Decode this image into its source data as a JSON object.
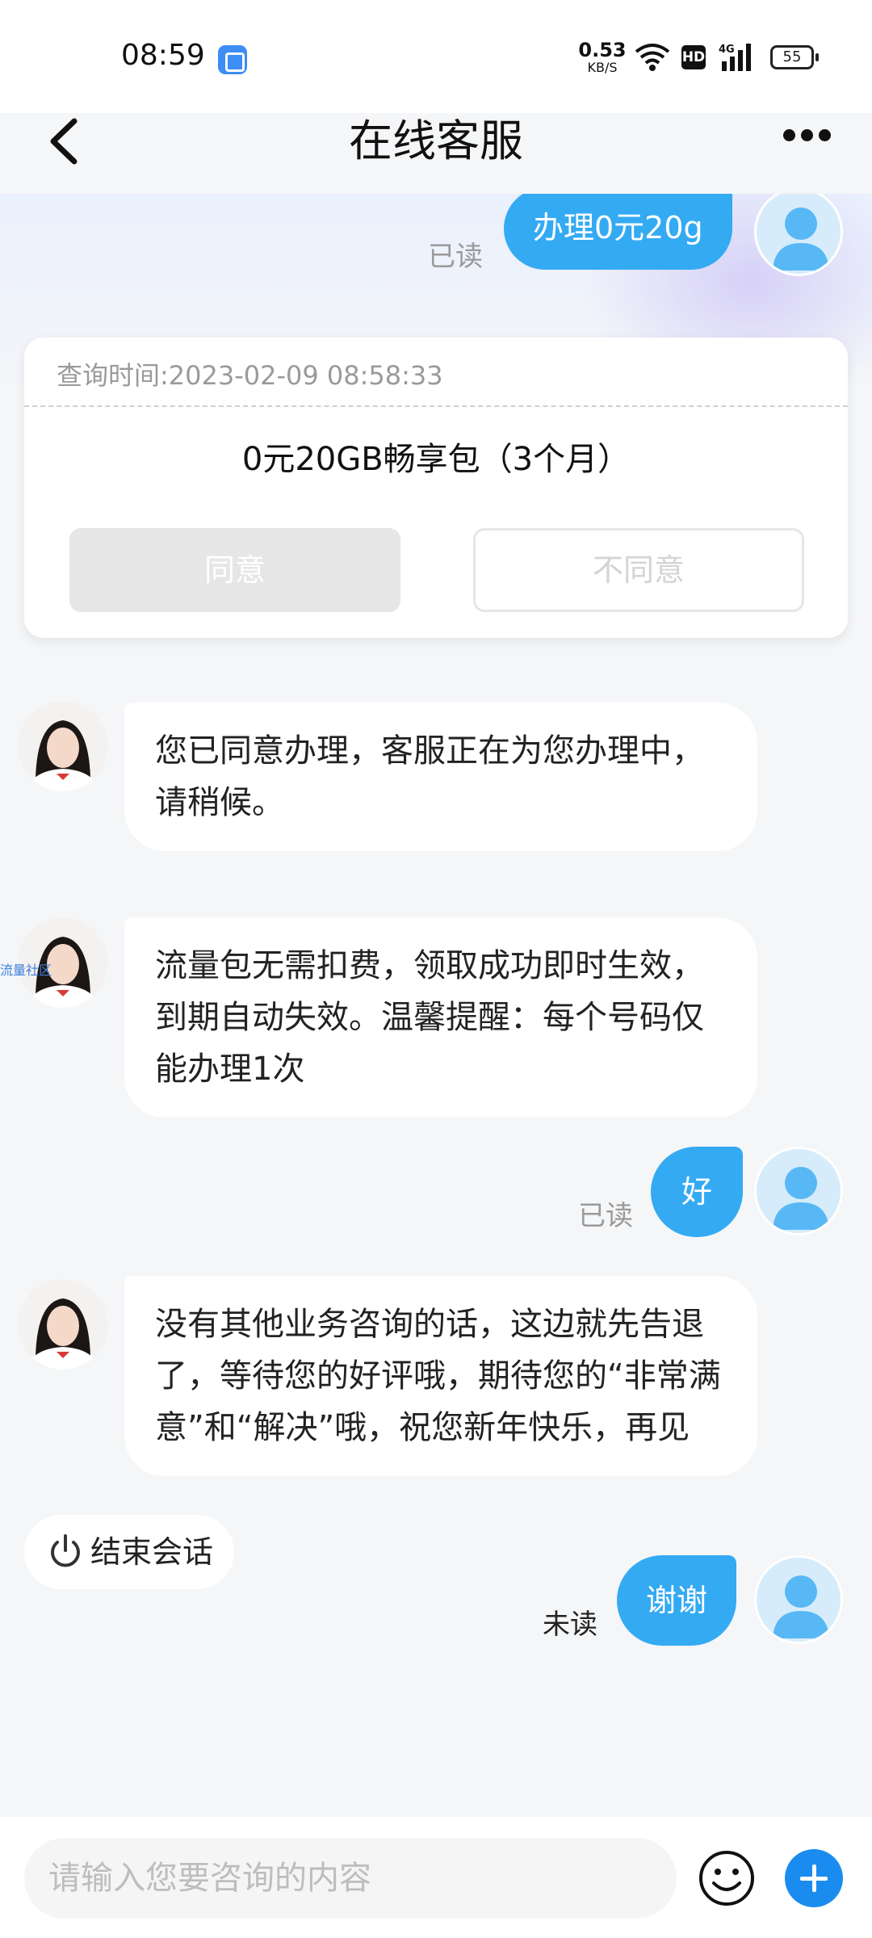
{
  "status_bar": {
    "time": "08:59",
    "net_speed": "0.53",
    "net_speed_unit": "KB/S",
    "hd": "HD",
    "network": "4G",
    "battery": "55"
  },
  "header": {
    "title": "在线客服"
  },
  "messages": {
    "m1": {
      "text": "办理0元20g",
      "status": "已读"
    },
    "card": {
      "query_time": "查询时间:2023-02-09 08:58:33",
      "product": "0元20GB畅享包（3个月）",
      "agree_label": "同意",
      "disagree_label": "不同意"
    },
    "m2": {
      "text": "您已同意办理，客服正在为您办理中，请稍候。"
    },
    "m3": {
      "text": "流量包无需扣费，领取成功即时生效，到期自动失效。温馨提醒：每个号码仅能办理1次"
    },
    "m4": {
      "text": "好",
      "status": "已读"
    },
    "m5": {
      "text": "没有其他业务咨询的话，这边就先告退了，等待您的好评哦，期待您的“非常满意”和“解决”哦，祝您新年快乐，再见"
    },
    "m6": {
      "text": "谢谢",
      "status": "未读"
    }
  },
  "watermark": "流量社区",
  "end_session_label": "结束会话",
  "input": {
    "placeholder": "请输入您要咨询的内容"
  },
  "colors": {
    "user_bubble": "#34aaf3",
    "send_plus": "#1a8cf0"
  },
  "icons": [
    "back-icon",
    "more-icon",
    "emoji-icon",
    "plus-icon",
    "power-icon",
    "wifi-icon",
    "signal-icon",
    "battery-icon"
  ]
}
